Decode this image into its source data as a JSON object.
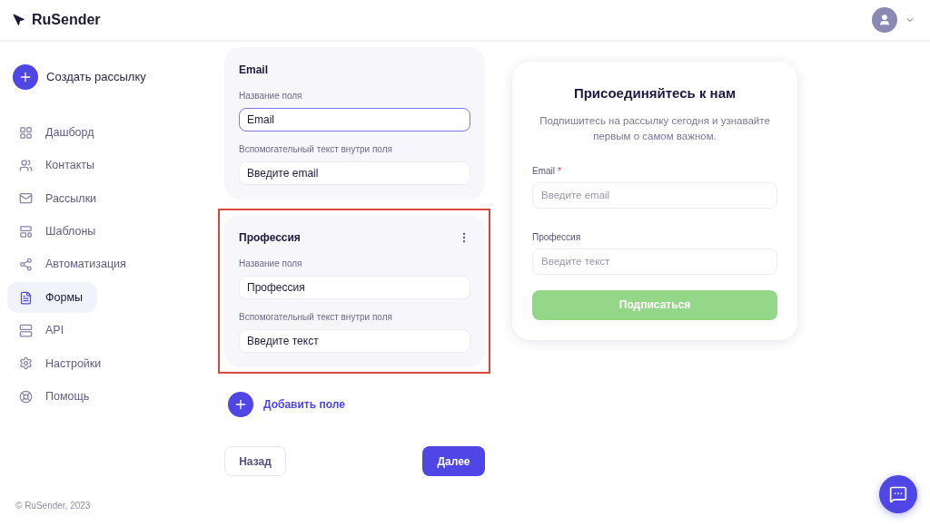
{
  "header": {
    "logo": "RuSender"
  },
  "sidebar": {
    "create_button": "Создать рассылку",
    "items": [
      {
        "label": "Дашборд",
        "kind": "grid",
        "selected": false
      },
      {
        "label": "Контакты",
        "kind": "users",
        "selected": false
      },
      {
        "label": "Рассылки",
        "kind": "mail",
        "selected": false
      },
      {
        "label": "Шаблоны",
        "kind": "template",
        "selected": false
      },
      {
        "label": "Автоматизация",
        "kind": "flow",
        "selected": false
      },
      {
        "label": "Формы",
        "kind": "form",
        "selected": true
      },
      {
        "label": "API",
        "kind": "server",
        "selected": false
      },
      {
        "label": "Настройки",
        "kind": "gear",
        "selected": false
      },
      {
        "label": "Помощь",
        "kind": "lifebuoy",
        "selected": false
      }
    ],
    "footer": "© RuSender, 2023"
  },
  "field_cards": [
    {
      "title": "Email",
      "name_field": {
        "label": "Название поля",
        "value": "Email",
        "focused": true
      },
      "hint_field": {
        "label": "Вспомогательный текст внутри поля",
        "value": "Введите email"
      },
      "highlighted": false,
      "has_menu": false
    },
    {
      "title": "Профессия",
      "name_field": {
        "label": "Название поля",
        "value": "Профессия",
        "focused": false
      },
      "hint_field": {
        "label": "Вспомогательный текст внутри поля",
        "value": "Введите текст"
      },
      "highlighted": true,
      "has_menu": true
    }
  ],
  "add_field": "Добавить поле",
  "back_button": "Назад",
  "next_button": "Далее",
  "preview": {
    "title": "Присоединяйтесь к нам",
    "subtitle": "Подпишитесь на рассылку сегодня и узнавайте первым о самом важном.",
    "fields": [
      {
        "label": "Email",
        "required_mark": "*",
        "placeholder": "Введите email"
      },
      {
        "label": "Профессия",
        "placeholder": "Введите текст"
      }
    ],
    "submit": "Подписаться"
  }
}
